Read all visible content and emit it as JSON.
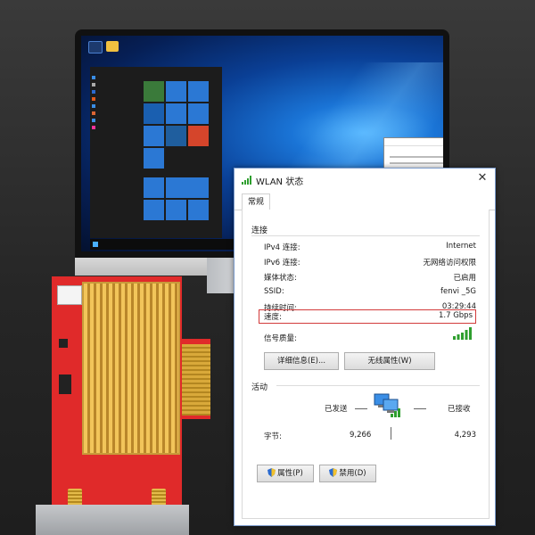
{
  "dialog": {
    "title": "WLAN 状态",
    "close_glyph": "✕",
    "tab": "常规",
    "connection": {
      "heading": "连接",
      "rows": [
        {
          "label": "IPv4 连接:",
          "value": "Internet"
        },
        {
          "label": "IPv6 连接:",
          "value": "无网络访问权限"
        },
        {
          "label": "媒体状态:",
          "value": "已启用"
        },
        {
          "label": "SSID:",
          "value": "fenvi _5G"
        },
        {
          "label": "持续时间:",
          "value": "03:29:44"
        },
        {
          "label": "速度:",
          "value": "1.7 Gbps"
        }
      ],
      "signal_label": "信号质量:",
      "signal_bars": 5,
      "details_button": "详细信息(E)...",
      "wireless_button": "无线属性(W)"
    },
    "activity": {
      "heading": "活动",
      "sent_label": "已发送",
      "received_label": "已接收",
      "bytes_label": "字节:",
      "bytes_sent": "9,266",
      "bytes_received": "4,293"
    },
    "properties_button": "属性(P)",
    "disable_button": "禁用(D)"
  },
  "colors": {
    "highlight": "#d23a3a",
    "signal": "#2e9e2e",
    "card": "#e02a2a"
  }
}
